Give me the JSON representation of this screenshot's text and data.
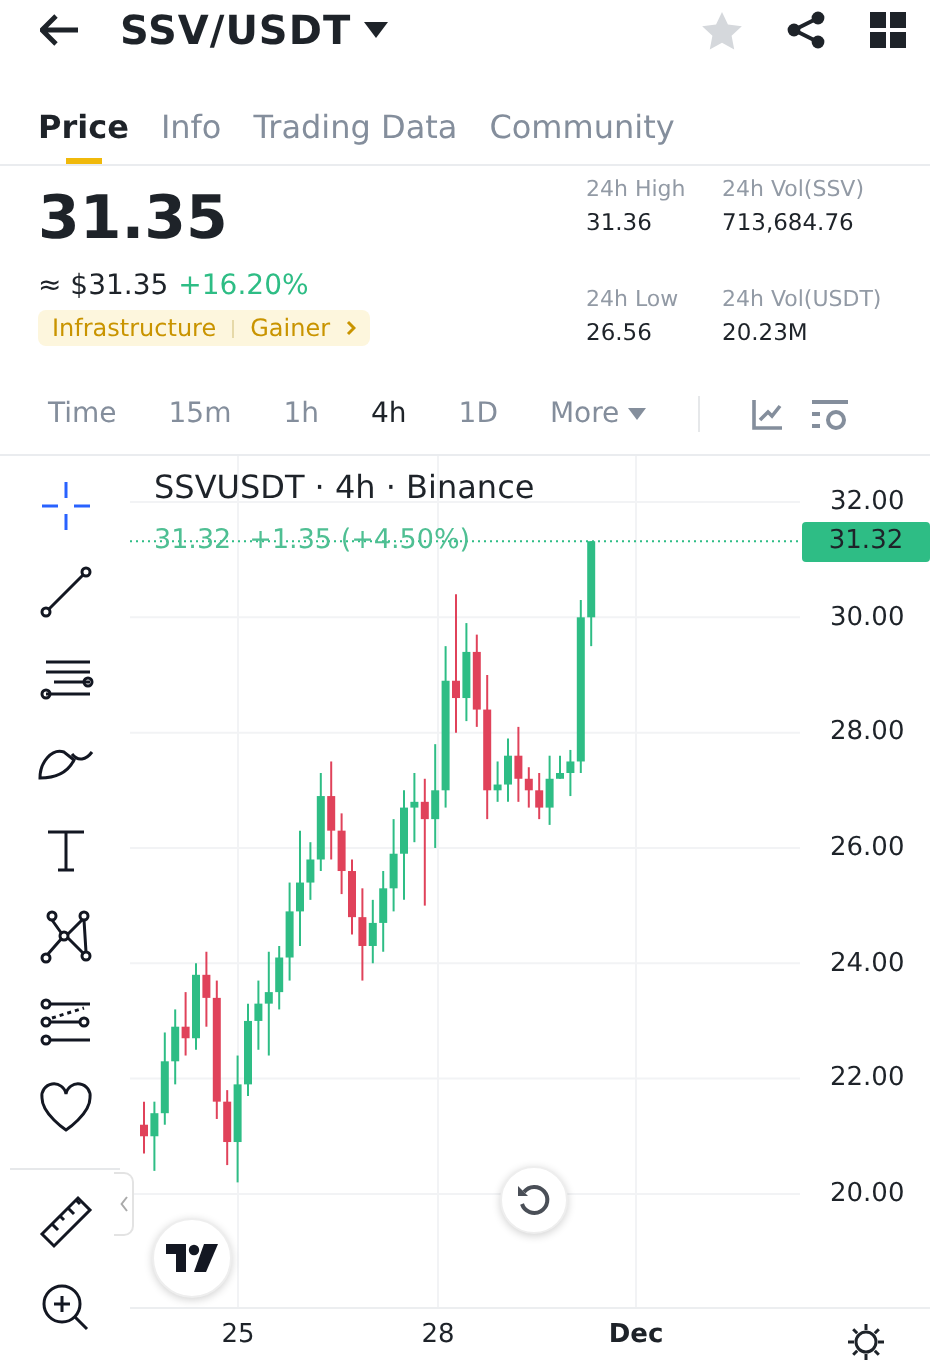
{
  "header": {
    "title": "SSV/USDT",
    "favorite": false
  },
  "tabs": [
    {
      "label": "Price",
      "selected": true
    },
    {
      "label": "Info",
      "selected": false
    },
    {
      "label": "Trading Data",
      "selected": false
    },
    {
      "label": "Community",
      "selected": false
    }
  ],
  "price": {
    "last": "31.35",
    "fiat": "≈ $31.35",
    "change": "+16.20%",
    "tags": [
      "Infrastructure",
      "Gainer"
    ]
  },
  "stats": [
    {
      "label": "24h High",
      "value": "31.36"
    },
    {
      "label": "24h Vol(SSV)",
      "value": "713,684.76"
    },
    {
      "label": "24h Low",
      "value": "26.56"
    },
    {
      "label": "24h Vol(USDT)",
      "value": "20.23M"
    }
  ],
  "intervals": [
    {
      "label": "Time",
      "selected": false
    },
    {
      "label": "15m",
      "selected": false
    },
    {
      "label": "1h",
      "selected": false
    },
    {
      "label": "4h",
      "selected": true
    },
    {
      "label": "1D",
      "selected": false
    },
    {
      "label": "More",
      "selected": false,
      "kind": "menu"
    }
  ],
  "tools": [
    {
      "kind": "crosshair",
      "selected": true
    },
    {
      "kind": "trendline",
      "selected": false
    },
    {
      "kind": "lines",
      "selected": false
    },
    {
      "kind": "brush",
      "selected": false
    },
    {
      "kind": "text",
      "selected": false
    },
    {
      "kind": "pattern",
      "selected": false
    },
    {
      "kind": "projection",
      "selected": false
    },
    {
      "kind": "heart",
      "selected": false
    },
    {
      "kind": "ruler",
      "selected": false
    },
    {
      "kind": "zoom",
      "selected": false
    }
  ],
  "chart": {
    "legend": "SSVUSDT · 4h · Binance",
    "last": "31.32",
    "change": "+1.35 (+4.50%)",
    "price_tag": "31.32",
    "y_labels": [
      "32.00",
      "30.00",
      "28.00",
      "26.00",
      "24.00",
      "22.00",
      "20.00"
    ],
    "x_labels": [
      {
        "label": "25",
        "bold": false
      },
      {
        "label": "28",
        "bold": false
      },
      {
        "label": "Dec",
        "bold": true
      }
    ]
  }
}
